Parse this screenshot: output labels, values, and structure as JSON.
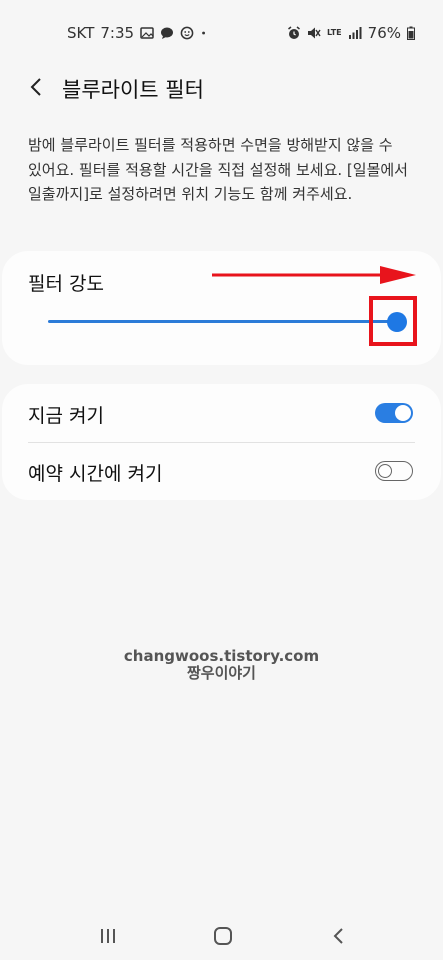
{
  "status_bar": {
    "carrier": "SKT",
    "time": "7:35",
    "notification_icons": [
      "gallery-icon",
      "message-bubble-icon",
      "face-badge-icon",
      "dot-icon"
    ],
    "system_icons": [
      "alarm-icon",
      "mute-icon",
      "lte-icon",
      "signal-icon"
    ],
    "battery": "76%",
    "lte_label": "LTE"
  },
  "header": {
    "title": "블루라이트 필터",
    "back_icon": "chevron-left-icon"
  },
  "description": "밤에 블루라이트 필터를 적용하면 수면을 방해받지 않을 수 있어요. 필터를 적용할 시간을 직접 설정해 보세요. [일몰에서 일출까지]로 설정하려면 위치 기능도 함께 켜주세요.",
  "intensity": {
    "label": "필터 강도",
    "slider_value": 1.0
  },
  "toggles": [
    {
      "label": "지금 켜기",
      "on": true
    },
    {
      "label": "예약 시간에 켜기",
      "on": false
    }
  ],
  "watermark": {
    "line1": "changwoos.tistory.com",
    "line2": "짱우이야기"
  },
  "colors": {
    "accent": "#1e78e4",
    "annotation": "#e8141c"
  },
  "nav_bar": {
    "icons": [
      "recent-apps-icon",
      "home-icon",
      "back-icon"
    ]
  }
}
